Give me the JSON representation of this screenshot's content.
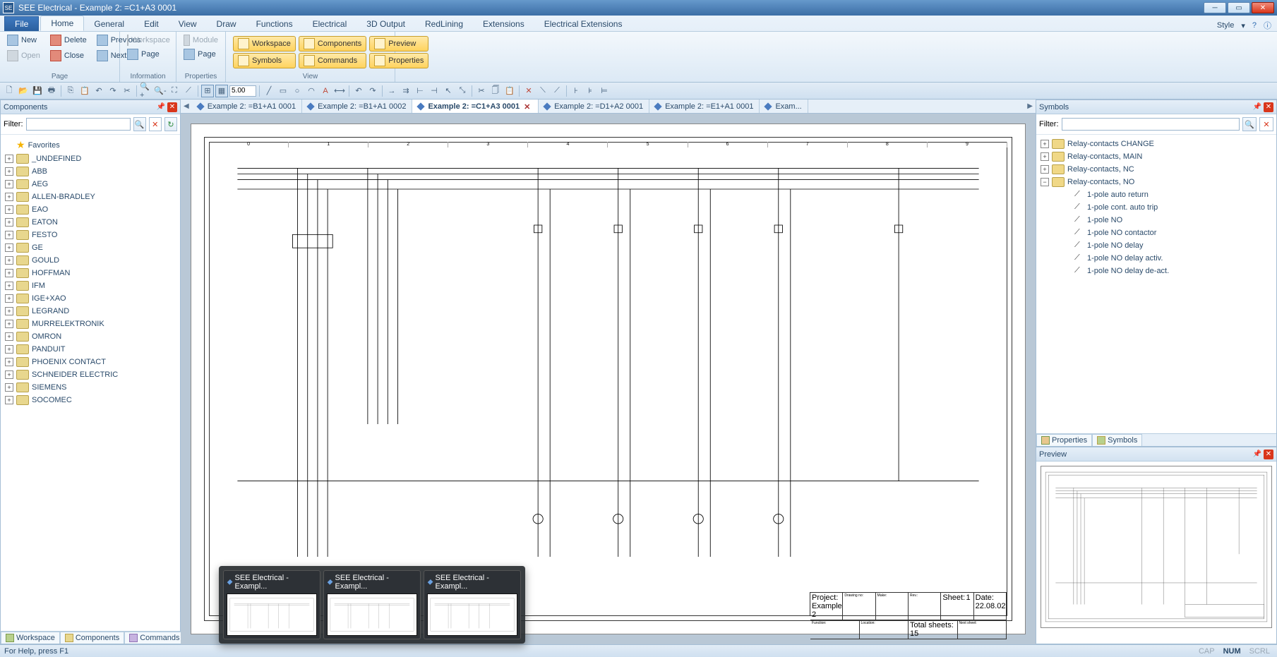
{
  "window": {
    "title": "SEE Electrical - Example 2: =C1+A3 0001"
  },
  "ribbon": {
    "file": "File",
    "tabs": [
      "Home",
      "General",
      "Edit",
      "View",
      "Draw",
      "Functions",
      "Electrical",
      "3D Output",
      "RedLining",
      "Extensions",
      "Electrical Extensions"
    ],
    "active": "Home",
    "style": "Style",
    "groups": {
      "page": {
        "label": "Page",
        "new": "New",
        "open": "Open",
        "delete": "Delete",
        "close": "Close",
        "previous": "Previous",
        "next": "Next"
      },
      "information": {
        "label": "Information",
        "workspace": "Workspace",
        "page": "Page"
      },
      "properties": {
        "label": "Properties",
        "module": "Module",
        "page": "Page"
      },
      "view": {
        "label": "View",
        "workspace": "Workspace",
        "symbols": "Symbols",
        "components": "Components",
        "commands": "Commands",
        "preview": "Preview",
        "properties": "Properties"
      }
    }
  },
  "qat": {
    "grid_value": "5.00"
  },
  "components": {
    "title": "Components",
    "filter_label": "Filter:",
    "filter": "",
    "favorites": "Favorites",
    "items": [
      "_UNDEFINED",
      "ABB",
      "AEG",
      "ALLEN-BRADLEY",
      "EAO",
      "EATON",
      "FESTO",
      "GE",
      "GOULD",
      "HOFFMAN",
      "IFM",
      "IGE+XAO",
      "LEGRAND",
      "MURRELEKTRONIK",
      "OMRON",
      "PANDUIT",
      "PHOENIX CONTACT",
      "SCHNEIDER ELECTRIC",
      "SIEMENS",
      "SOCOMEC"
    ],
    "bottom_tabs": [
      "Workspace",
      "Components",
      "Commands"
    ]
  },
  "doc_tabs": [
    {
      "label": "Example 2: =B1+A1 0001",
      "active": false
    },
    {
      "label": "Example 2: =B1+A1 0002",
      "active": false
    },
    {
      "label": "Example 2: =C1+A3 0001",
      "active": true
    },
    {
      "label": "Example 2: =D1+A2 0001",
      "active": false
    },
    {
      "label": "Example 2: =E1+A1 0001",
      "active": false
    },
    {
      "label": "Exam...",
      "active": false
    }
  ],
  "symbols": {
    "title": "Symbols",
    "filter_label": "Filter:",
    "filter": "",
    "folders": [
      {
        "name": "Relay-contacts CHANGE",
        "expanded": false
      },
      {
        "name": "Relay-contacts, MAIN",
        "expanded": false
      },
      {
        "name": "Relay-contacts, NC",
        "expanded": false
      },
      {
        "name": "Relay-contacts, NO",
        "expanded": true,
        "children": [
          "1-pole auto return",
          "1-pole cont. auto trip",
          "1-pole NO",
          "1-pole NO contactor",
          "1-pole NO delay",
          "1-pole NO delay activ.",
          "1-pole NO delay de-act."
        ]
      }
    ],
    "bottom_tabs": [
      "Properties",
      "Symbols"
    ]
  },
  "preview": {
    "title": "Preview"
  },
  "statusbar": {
    "help": "For Help, press F1",
    "indicators": [
      "CAP",
      "NUM",
      "SCRL"
    ]
  },
  "taskbar_previews": [
    "SEE Electrical - Exampl...",
    "SEE Electrical - Exampl...",
    "SEE Electrical - Exampl..."
  ],
  "schematic": {
    "columns": [
      "0",
      "1",
      "2",
      "3",
      "4",
      "5",
      "6",
      "7",
      "8",
      "9"
    ],
    "titleblock": {
      "project_l": "Project:",
      "project": "Example 2",
      "drawing_l": "Drawing no:",
      "sheet_l": "Sheet:",
      "sheet": "1",
      "rev_l": "Rev.:",
      "function_l": "Function:",
      "location_l": "Location:",
      "total_l": "Total sheets:",
      "next_l": "Next sheet:",
      "date_l": "Date:",
      "date": "22.08.02",
      "make_l": "Make:",
      "page": "1",
      "total": "15"
    }
  }
}
